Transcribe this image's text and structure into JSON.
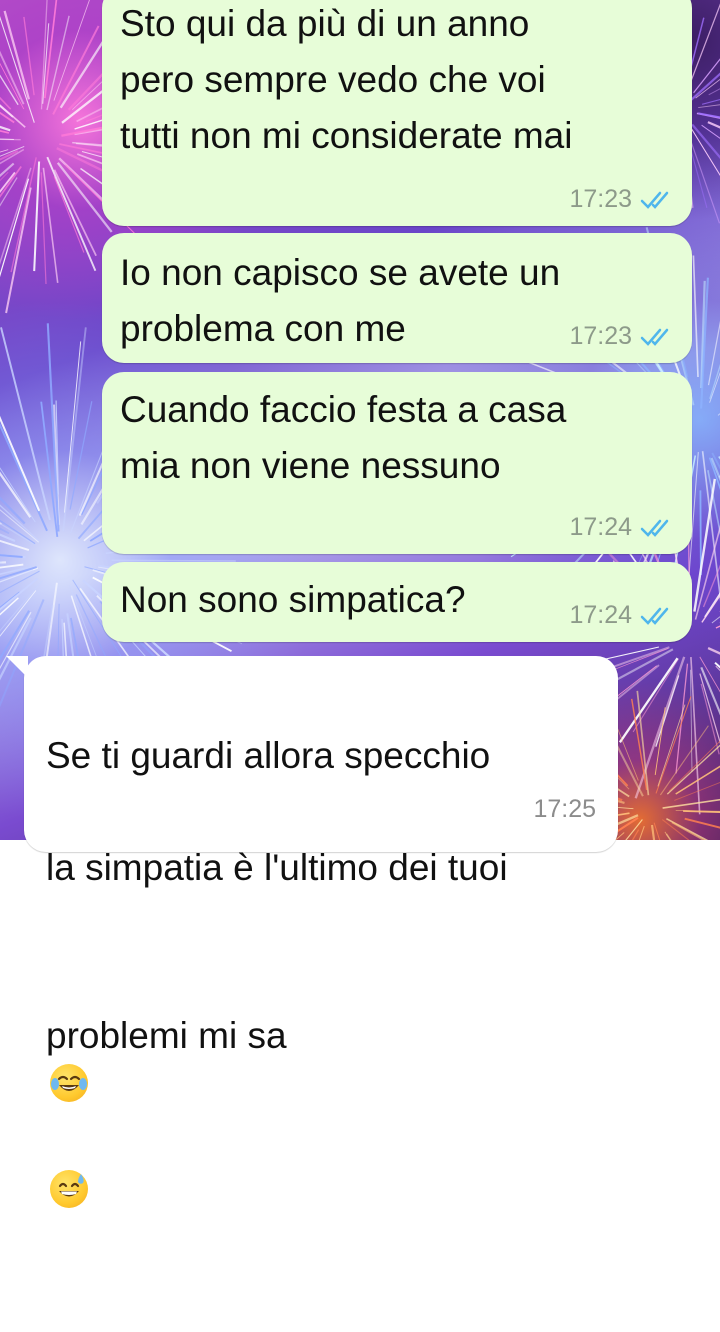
{
  "messages": [
    {
      "direction": "outgoing",
      "text": "Sto qui da più di un anno\npero sempre vedo che voi\ntutti non mi considerate mai",
      "time": "17:23",
      "status_icon": "double-check-read-icon"
    },
    {
      "direction": "outgoing",
      "text": "Io non capisco se avete un\nproblema con me",
      "time": "17:23",
      "status_icon": "double-check-read-icon"
    },
    {
      "direction": "outgoing",
      "text": "Cuando faccio festa a casa\nmia non viene nessuno",
      "time": "17:24",
      "status_icon": "double-check-read-icon"
    },
    {
      "direction": "outgoing",
      "text": "Non sono simpatica?",
      "time": "17:24",
      "status_icon": "double-check-read-icon"
    },
    {
      "direction": "incoming",
      "text_lines": [
        "Se ti guardi allora specchio",
        "la simpatia è l'ultimo dei tuoi",
        "problemi mi sa"
      ],
      "emojis": [
        "face-with-tears-of-joy-emoji",
        "grinning-face-with-sweat-emoji"
      ],
      "time": "17:25"
    }
  ],
  "colors": {
    "outgoing_bubble": "#e7fdd8",
    "incoming_bubble": "#ffffff",
    "read_ticks": "#4fb6ec",
    "timestamp": "#8d9a8a"
  },
  "wallpaper": "fireworks"
}
